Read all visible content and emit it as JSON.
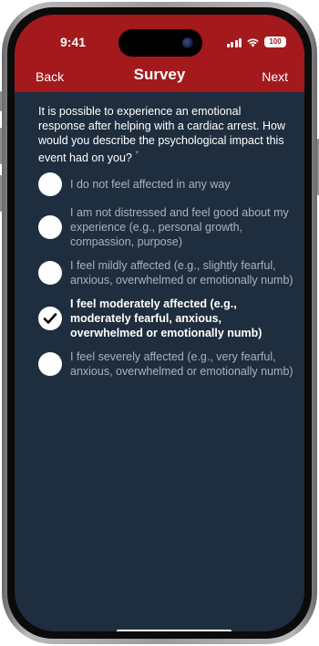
{
  "status_bar": {
    "time": "9:41",
    "battery": "100",
    "icons": [
      "signal-icon",
      "wifi-icon",
      "battery-icon",
      "camera-icon"
    ]
  },
  "nav": {
    "back_label": "Back",
    "title": "Survey",
    "next_label": "Next"
  },
  "question": {
    "text": "It is possible to experience an emotional response after helping with a cardiac arrest. How would you describe the psychological impact this event had on you?",
    "required_marker": "*"
  },
  "options": [
    {
      "label": "I do not feel affected in any way",
      "selected": false
    },
    {
      "label": "I am not distressed and feel good about my experience (e.g., personal growth, compassion, purpose)",
      "selected": false
    },
    {
      "label": "I feel mildly affected (e.g., slightly fearful, anxious, overwhelmed or emotionally numb)",
      "selected": false
    },
    {
      "label": "I feel moderately affected (e.g., moderately fearful, anxious, overwhelmed or emotionally numb)",
      "selected": true
    },
    {
      "label": "I feel severely affected (e.g., very fearful, anxious, overwhelmed or emotionally numb)",
      "selected": false
    }
  ],
  "colors": {
    "header": "#a3191c",
    "background": "#1f2e3e",
    "option_text": "#a9b2bb",
    "selected_text": "#ffffff",
    "required_marker": "#d9893b"
  }
}
